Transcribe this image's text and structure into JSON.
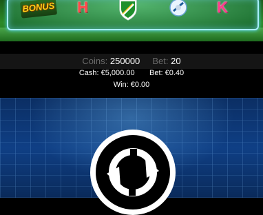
{
  "reels": {
    "symbols": [
      {
        "name": "bonus",
        "text": "BONUS"
      },
      {
        "name": "h",
        "text": "H"
      },
      {
        "name": "shield",
        "text": ""
      },
      {
        "name": "ball",
        "text": ""
      },
      {
        "name": "k",
        "text": "K"
      }
    ]
  },
  "info": {
    "coins_label": "Coins:",
    "coins_value": "250000",
    "bet_label": "Bet:",
    "bet_value": "20",
    "cash_label": "Cash:",
    "cash_value": "€5,000.00",
    "bet_money_label": "Bet:",
    "bet_money_value": "€0.40",
    "win_label": "Win:",
    "win_value": "€0.00"
  },
  "spin_button": {
    "icon": "refresh-icon"
  }
}
